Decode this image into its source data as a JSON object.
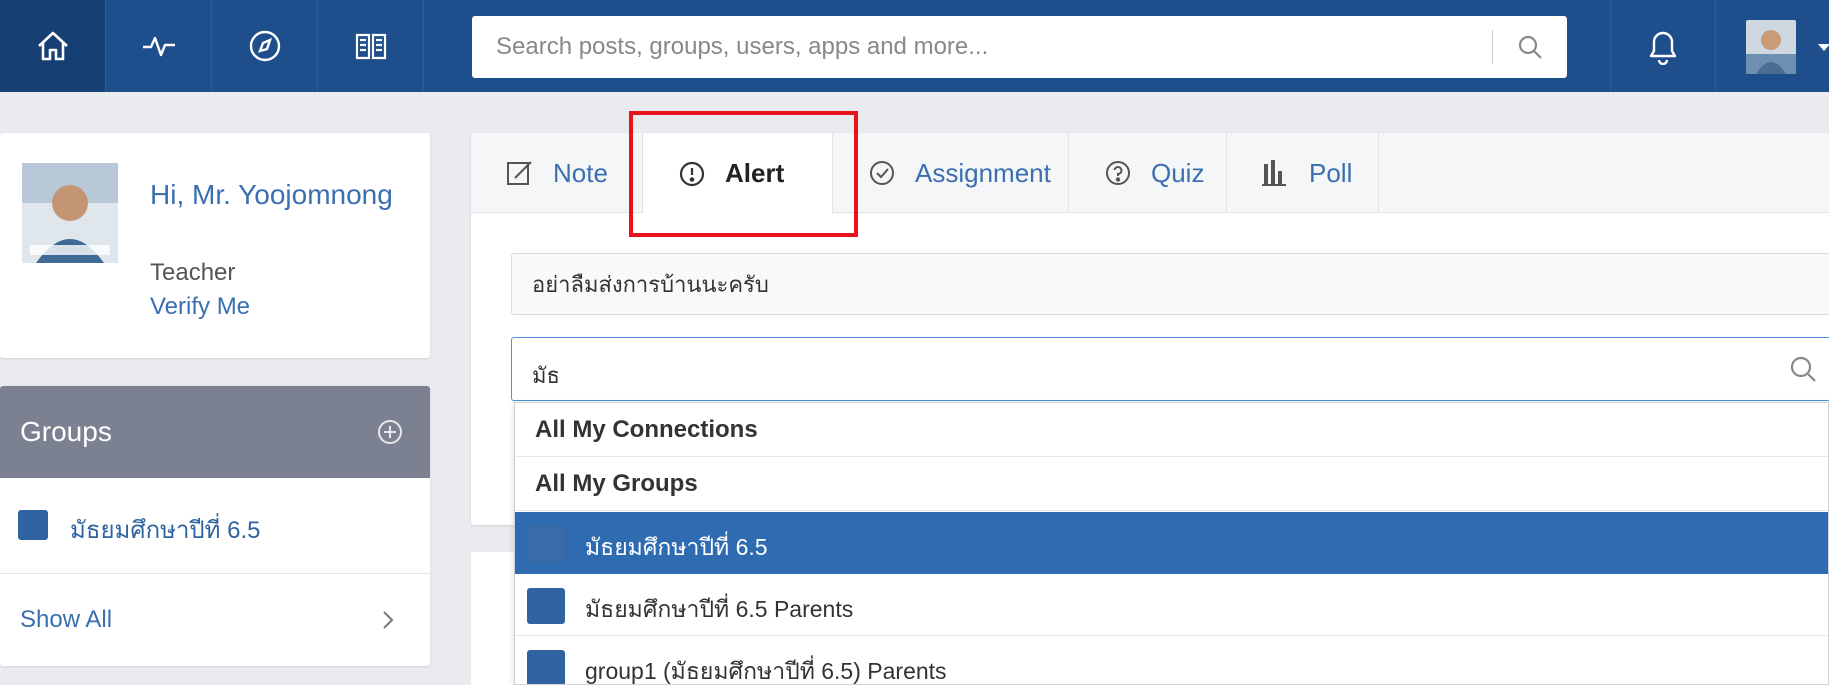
{
  "topbar": {
    "search_placeholder": "Search posts, groups, users, apps and more...",
    "nav_icons": [
      "home-icon",
      "activity-icon",
      "discover-icon",
      "library-icon"
    ],
    "accent": "#1f4e8c"
  },
  "profile": {
    "greeting": "Hi, Mr. Yoojomnong",
    "role": "Teacher",
    "verify_label": "Verify Me"
  },
  "groups": {
    "title": "Groups",
    "items": [
      {
        "label": "มัธยมศึกษาปีที่ 6.5"
      }
    ],
    "show_all": "Show All"
  },
  "composer": {
    "tabs": [
      {
        "label": "Note",
        "icon": "note-icon"
      },
      {
        "label": "Alert",
        "icon": "alert-icon",
        "active": true
      },
      {
        "label": "Assignment",
        "icon": "assignment-icon"
      },
      {
        "label": "Quiz",
        "icon": "quiz-icon"
      },
      {
        "label": "Poll",
        "icon": "poll-icon"
      }
    ],
    "message_value": "อย่าลืมส่งการบ้านนะครับ",
    "recipient_value": "มัธ"
  },
  "dropdown": {
    "headers": [
      "All My Connections",
      "All My Groups"
    ],
    "items": [
      {
        "label": "มัธยมศึกษาปีที่ 6.5",
        "selected": true
      },
      {
        "label": "มัธยมศึกษาปีที่ 6.5 Parents"
      },
      {
        "label": "group1 (มัธยมศึกษาปีที่ 6.5) Parents"
      }
    ]
  },
  "colors": {
    "highlight": "#e8131b",
    "selected_row": "#2f6bb0",
    "group_swatch": "#2f64a1"
  }
}
